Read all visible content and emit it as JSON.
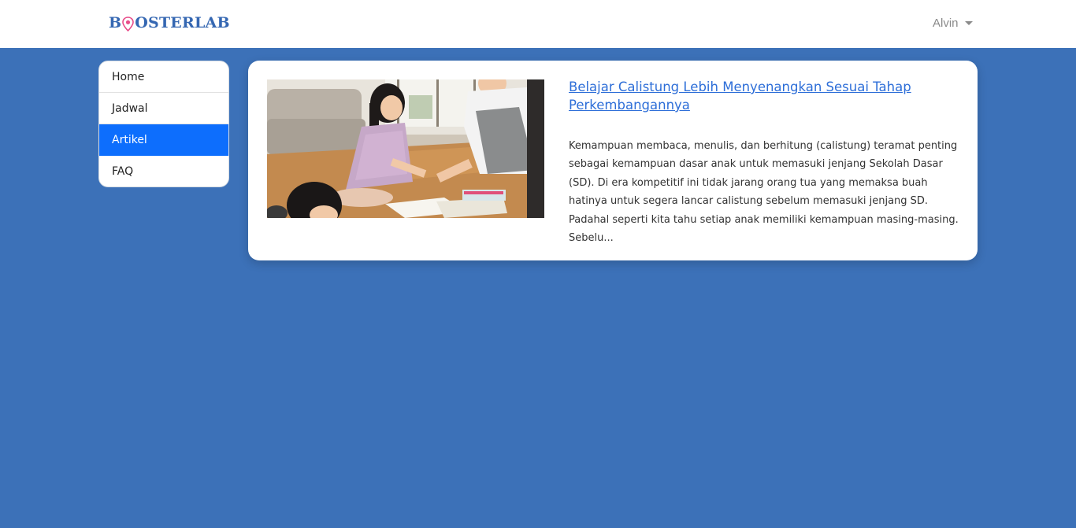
{
  "header": {
    "brand_prefix": "B",
    "brand_suffix": "OSTERLAB",
    "brand_color": "#3567b2",
    "brand_pin_color": "#e84d8a",
    "user_name": "Alvin"
  },
  "sidebar": {
    "items": [
      {
        "label": "Home",
        "active": false
      },
      {
        "label": "Jadwal",
        "active": false
      },
      {
        "label": "Artikel",
        "active": true
      },
      {
        "label": "FAQ",
        "active": false
      }
    ],
    "active_color": "#0d6efd"
  },
  "article": {
    "title": "Belajar Calistung Lebih Menyenangkan Sesuai Tahap Perkembangannya",
    "excerpt": "Kemampuan membaca, menulis, dan berhitung (calistung) teramat penting sebagai kemampuan dasar anak untuk memasuki jenjang Sekolah Dasar (SD). Di era kompetitif ini tidak jarang orang tua yang memaksa buah hatinya untuk segera lancar calistung sebelum memasuki jenjang SD. Padahal seperti kita tahu setiap anak memiliki kemampuan masing-masing. Sebelu...",
    "image_icon": "photo-children-studying"
  },
  "colors": {
    "page_background": "#3c71b8",
    "link": "#2d6ed8"
  }
}
